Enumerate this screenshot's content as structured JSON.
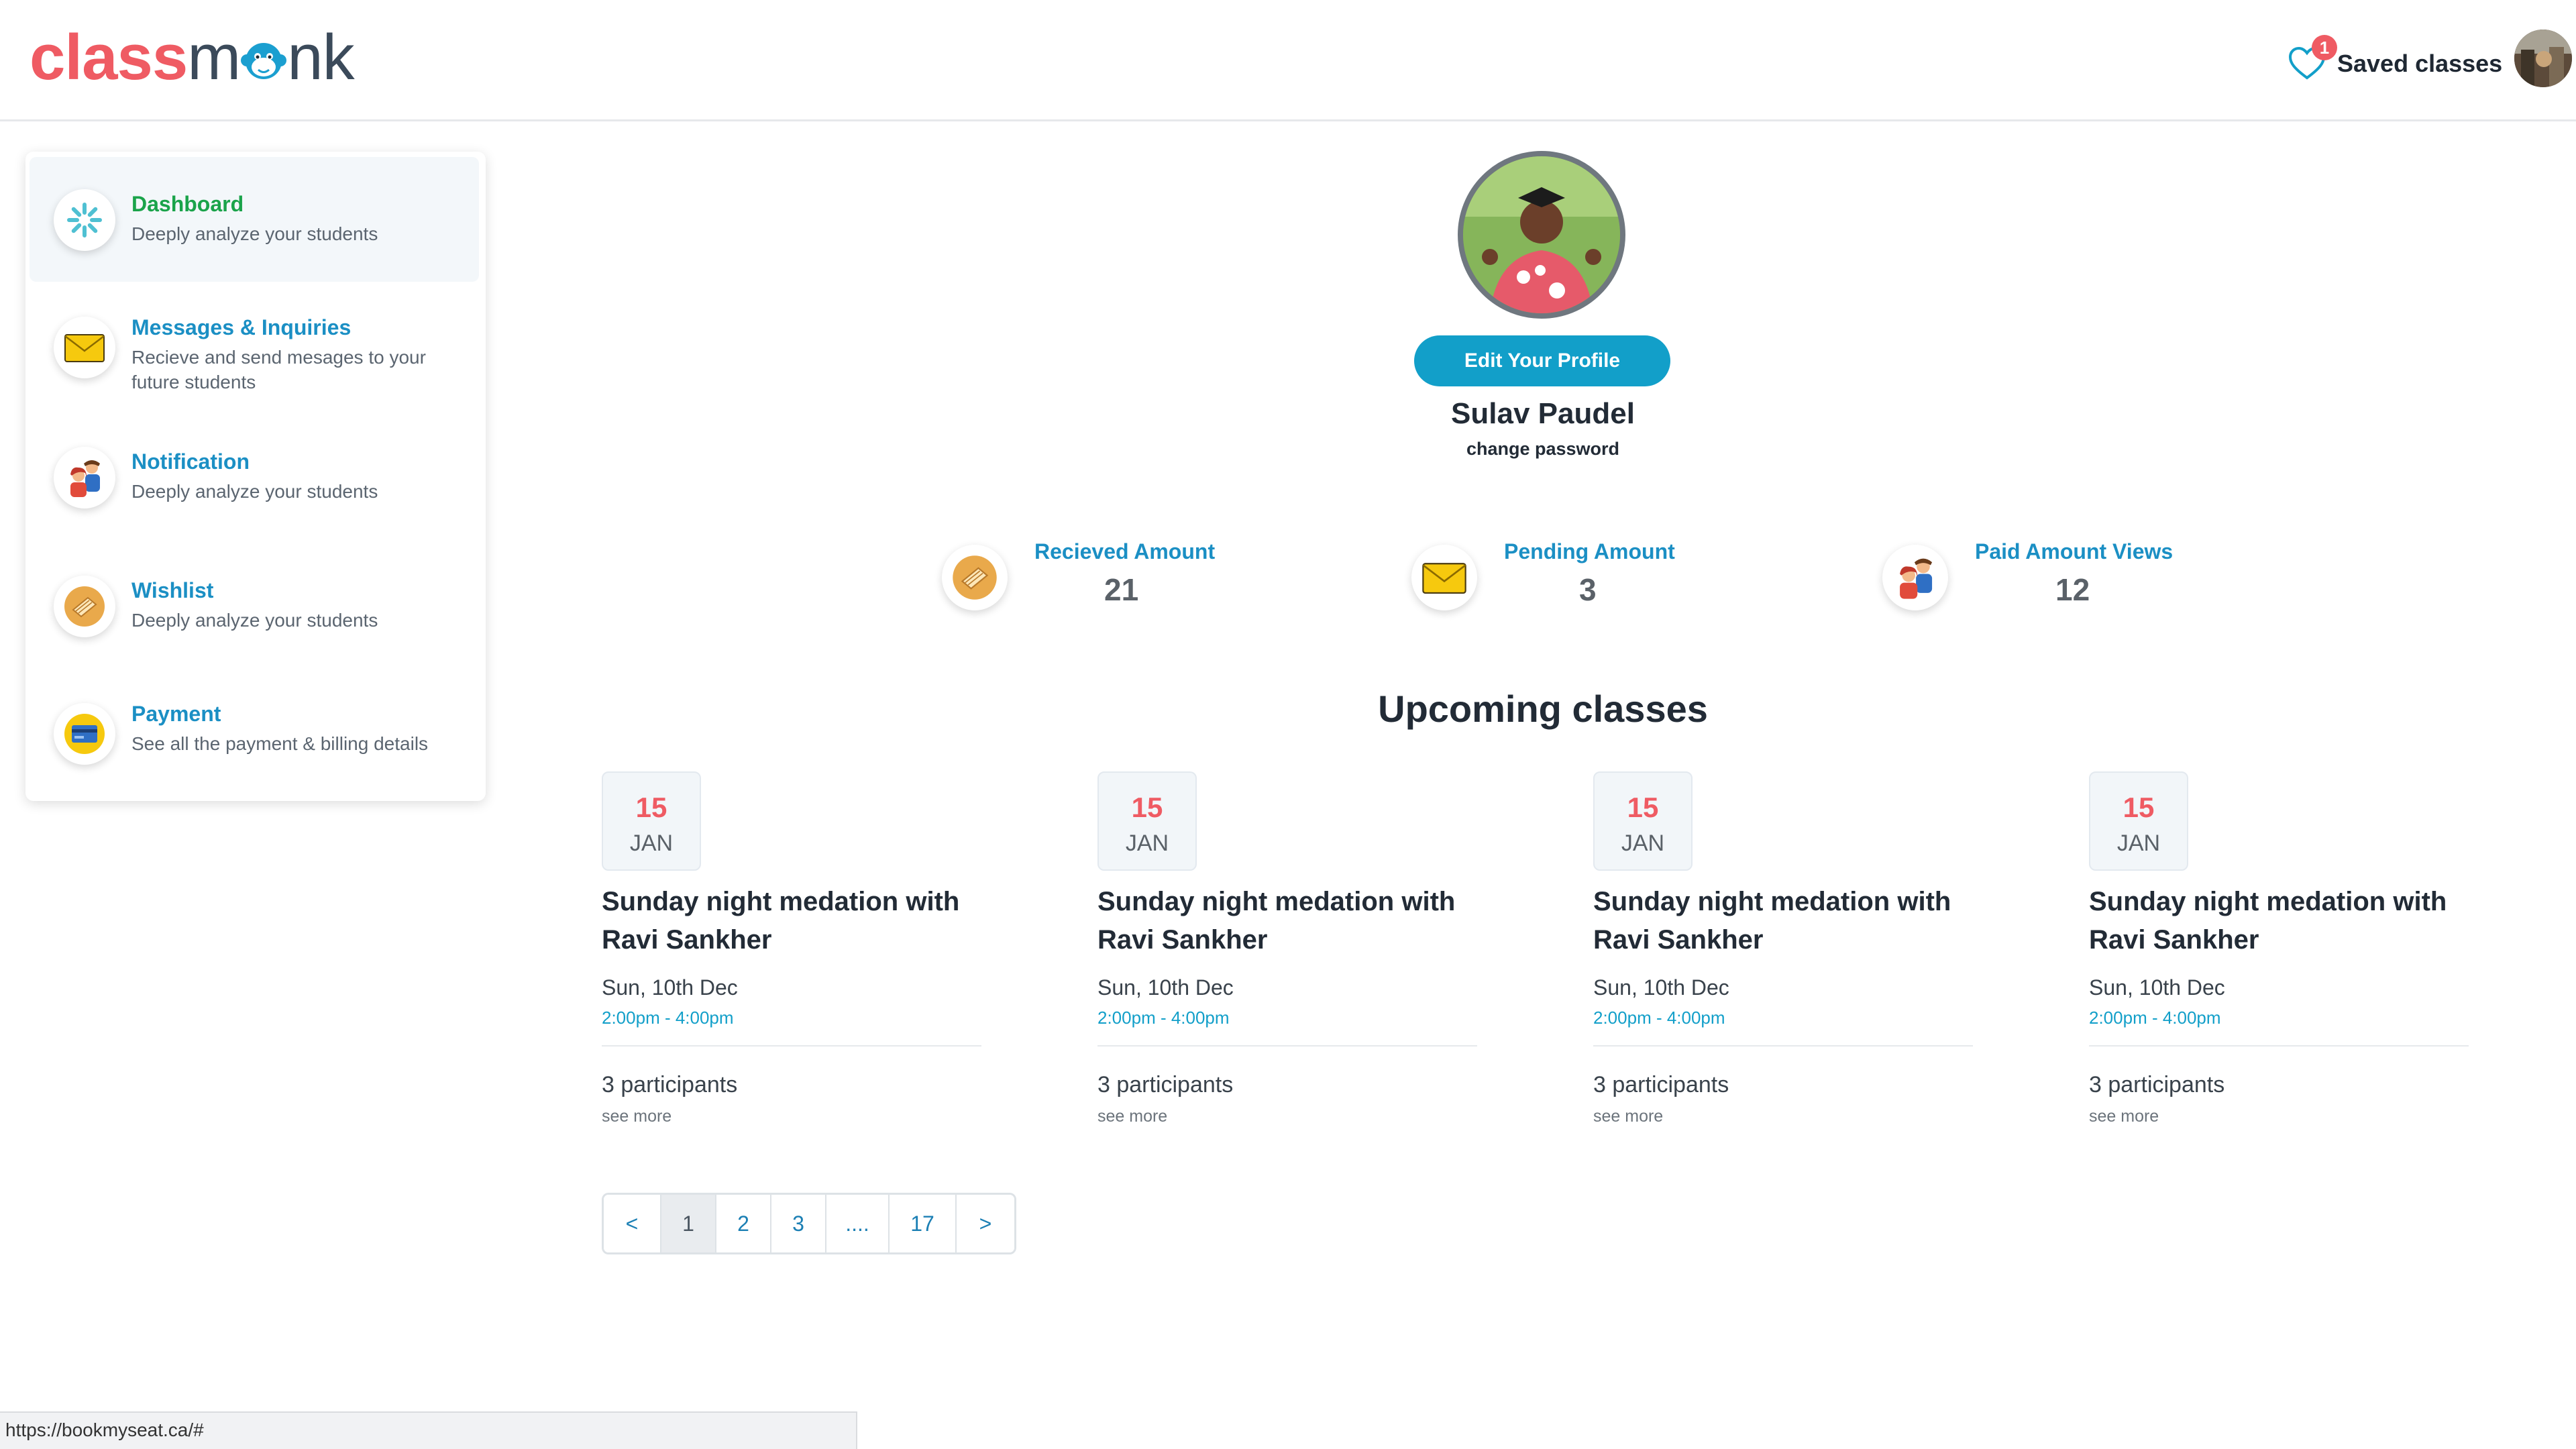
{
  "header": {
    "logo_part1": "class",
    "logo_part2": "m",
    "logo_part3": "nk",
    "saved_count": "1",
    "saved_label": "Saved classes"
  },
  "sidebar": {
    "items": [
      {
        "title": "Dashboard",
        "desc": "Deeply analyze your students",
        "icon": "dashboard-icon"
      },
      {
        "title": "Messages & Inquiries",
        "desc": "Recieve and send mesages to your future students",
        "icon": "envelope-icon"
      },
      {
        "title": "Notification",
        "desc": "Deeply analyze your students",
        "icon": "people-icon"
      },
      {
        "title": "Wishlist",
        "desc": "Deeply analyze your students",
        "icon": "book-icon"
      },
      {
        "title": "Payment",
        "desc": "See all the payment & billing details",
        "icon": "credit-card-icon"
      }
    ]
  },
  "profile": {
    "edit_label": "Edit Your Profile",
    "name": "Sulav Paudel",
    "change_password": "change password"
  },
  "stats": [
    {
      "label": "Recieved Amount",
      "value": "21",
      "icon": "book-icon"
    },
    {
      "label": "Pending Amount",
      "value": "3",
      "icon": "envelope-icon"
    },
    {
      "label": "Paid Amount Views",
      "value": "12",
      "icon": "people-icon"
    }
  ],
  "upcoming": {
    "title": "Upcoming classes",
    "classes": [
      {
        "day": "15",
        "month": "JAN",
        "title": "Sunday night medation with Ravi Sankher",
        "date": "Sun, 10th Dec",
        "time": "2:00pm - 4:00pm",
        "participants": "3 participants",
        "see_more": "see more"
      },
      {
        "day": "15",
        "month": "JAN",
        "title": "Sunday night medation with Ravi Sankher",
        "date": "Sun, 10th Dec",
        "time": "2:00pm - 4:00pm",
        "participants": "3 participants",
        "see_more": "see more"
      },
      {
        "day": "15",
        "month": "JAN",
        "title": "Sunday night medation with Ravi Sankher",
        "date": "Sun, 10th Dec",
        "time": "2:00pm - 4:00pm",
        "participants": "3 participants",
        "see_more": "see more"
      },
      {
        "day": "15",
        "month": "JAN",
        "title": "Sunday night medation with Ravi Sankher",
        "date": "Sun, 10th Dec",
        "time": "2:00pm - 4:00pm",
        "participants": "3 participants",
        "see_more": "see more"
      }
    ]
  },
  "pagination": {
    "prev": "<",
    "pages": [
      "1",
      "2",
      "3",
      "....",
      "17"
    ],
    "next": ">",
    "current": "1"
  },
  "statusbar": {
    "url": "https://bookmyseat.ca/#"
  },
  "colors": {
    "brand_red": "#ef5b63",
    "accent_blue": "#129fc9",
    "active_green": "#1aa34a"
  }
}
